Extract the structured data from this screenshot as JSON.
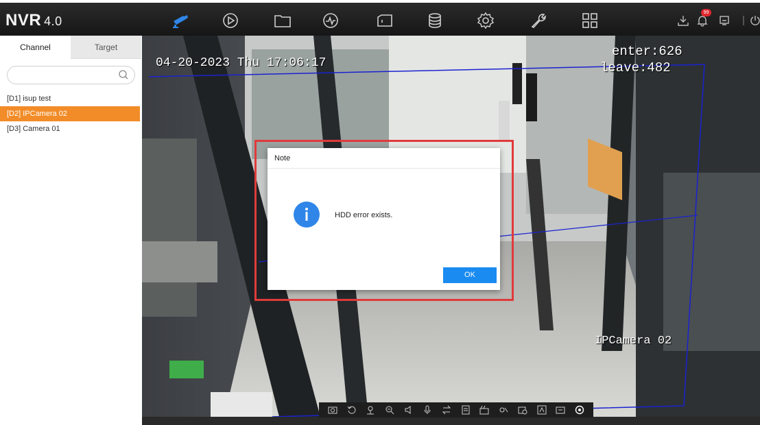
{
  "app": {
    "logo_name": "NVR",
    "logo_version": "4.0"
  },
  "topnav": [
    {
      "name": "live-view-icon",
      "active": true
    },
    {
      "name": "playback-icon"
    },
    {
      "name": "file-management-icon"
    },
    {
      "name": "smart-analysis-icon"
    },
    {
      "name": "camera-management-icon"
    },
    {
      "name": "storage-icon"
    },
    {
      "name": "configuration-icon"
    },
    {
      "name": "maintenance-icon"
    },
    {
      "name": "menu-grid-icon"
    }
  ],
  "system": {
    "alarm_count": "99"
  },
  "left": {
    "tabs": {
      "channel": "Channel",
      "target": "Target"
    },
    "search_placeholder": "",
    "channels": [
      "[D1] isup test",
      "[D2] IPCamera 02",
      "[D3] Camera 01"
    ],
    "selected_index": 1
  },
  "video": {
    "timestamp": "04-20-2023 Thu 17:06:17",
    "enter": "enter:626",
    "leave": "leave:482",
    "camera_name": "IPCamera 02"
  },
  "dialog": {
    "title": "Note",
    "message": "HDD error exists.",
    "ok_label": "OK"
  },
  "colors": {
    "selected": "#f28c28",
    "accent": "#1a8bf0",
    "highlight": "#e03a3a",
    "info": "#2f86e8"
  }
}
